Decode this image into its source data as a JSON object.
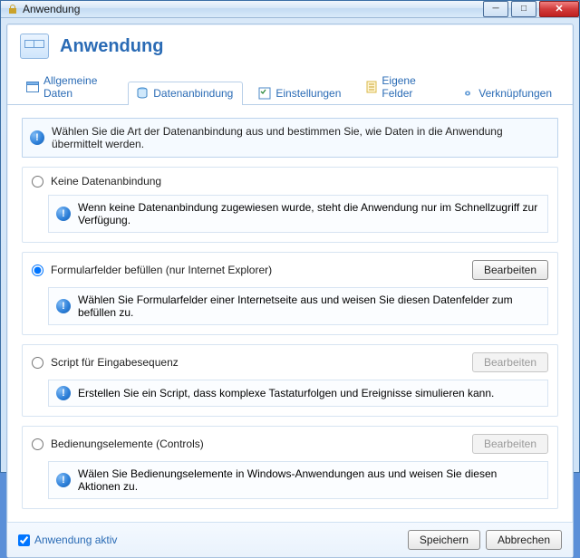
{
  "window": {
    "title": "Anwendung"
  },
  "header": {
    "title": "Anwendung"
  },
  "tabs": {
    "general": "Allgemeine Daten",
    "data": "Datenanbindung",
    "settings": "Einstellungen",
    "custom": "Eigene Felder",
    "links": "Verknüpfungen"
  },
  "intro": "Wählen Sie die Art der Datenanbindung aus und bestimmen Sie, wie Daten in die Anwendung übermittelt werden.",
  "options": {
    "none": {
      "label": "Keine Datenanbindung",
      "info": "Wenn keine Datenanbindung zugewiesen wurde, steht die Anwendung nur im Schnellzugriff zur Verfügung."
    },
    "form": {
      "label": "Formularfelder befüllen (nur Internet Explorer)",
      "button": "Bearbeiten",
      "info": "Wählen Sie Formularfelder einer Internetseite aus und weisen Sie diesen Datenfelder zum befüllen zu."
    },
    "script": {
      "label": "Script für Eingabesequenz",
      "button": "Bearbeiten",
      "info": "Erstellen Sie ein Script, dass komplexe Tastaturfolgen und Ereignisse simulieren kann."
    },
    "controls": {
      "label": "Bedienungselemente (Controls)",
      "button": "Bearbeiten",
      "info": "Wälen Sie Bedienungselemente in Windows-Anwendungen aus und weisen Sie diesen Aktionen zu."
    }
  },
  "footer": {
    "active": "Anwendung aktiv",
    "save": "Speichern",
    "cancel": "Abbrechen"
  }
}
